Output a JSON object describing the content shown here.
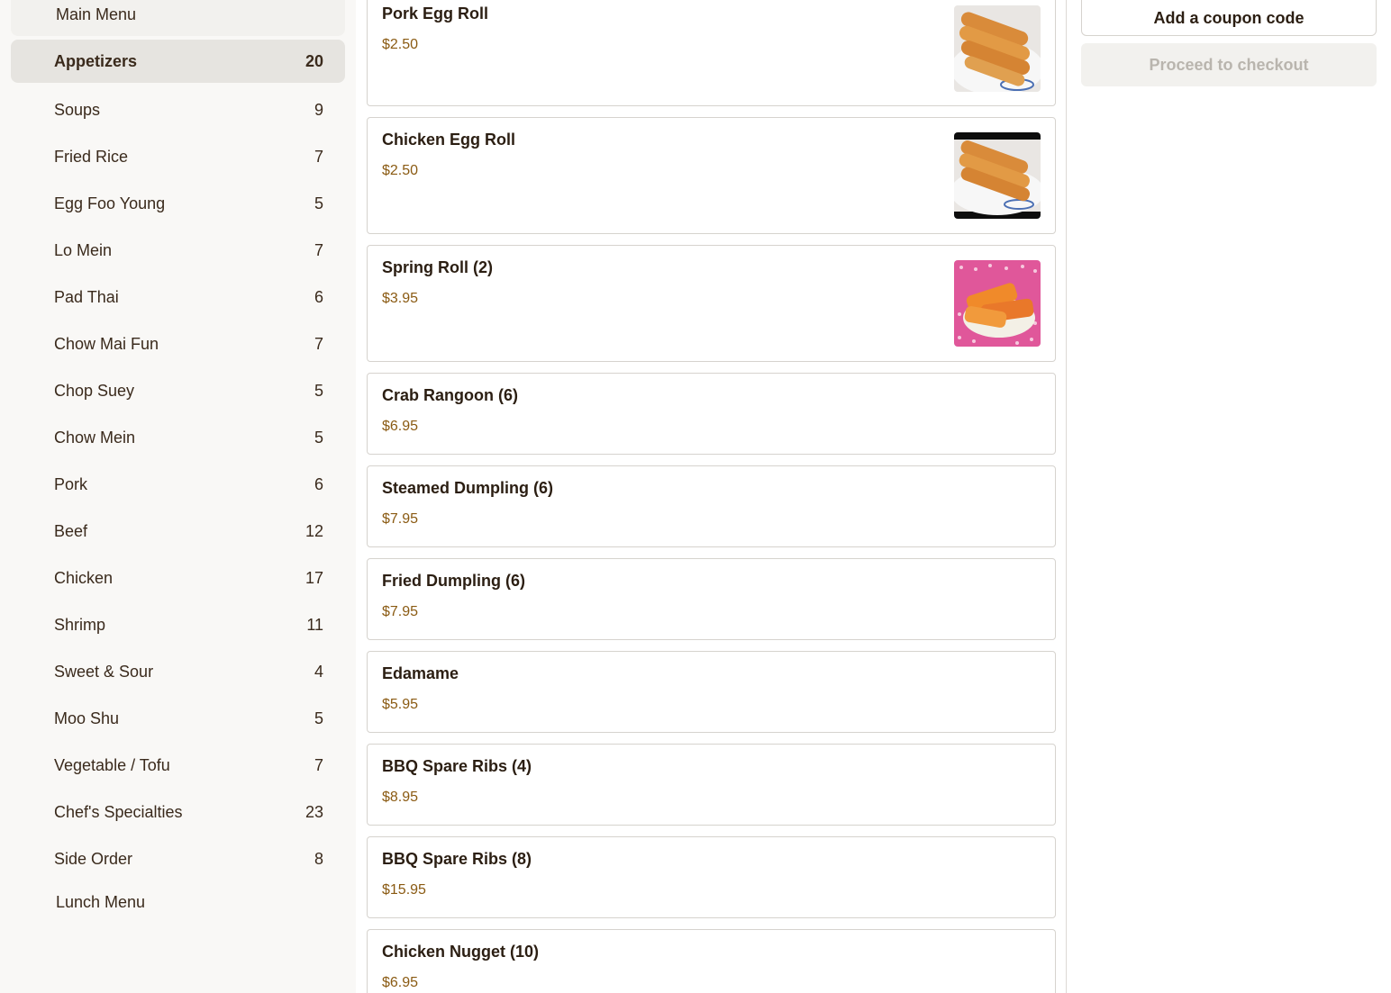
{
  "sidebar": {
    "main_menu_label": "Main Menu",
    "lunch_menu_label": "Lunch Menu",
    "categories": [
      {
        "label": "Appetizers",
        "count": "20"
      },
      {
        "label": "Soups",
        "count": "9"
      },
      {
        "label": "Fried Rice",
        "count": "7"
      },
      {
        "label": "Egg Foo Young",
        "count": "5"
      },
      {
        "label": "Lo Mein",
        "count": "7"
      },
      {
        "label": "Pad Thai",
        "count": "6"
      },
      {
        "label": "Chow Mai Fun",
        "count": "7"
      },
      {
        "label": "Chop Suey",
        "count": "5"
      },
      {
        "label": "Chow Mein",
        "count": "5"
      },
      {
        "label": "Pork",
        "count": "6"
      },
      {
        "label": "Beef",
        "count": "12"
      },
      {
        "label": "Chicken",
        "count": "17"
      },
      {
        "label": "Shrimp",
        "count": "11"
      },
      {
        "label": "Sweet & Sour",
        "count": "4"
      },
      {
        "label": "Moo Shu",
        "count": "5"
      },
      {
        "label": "Vegetable / Tofu",
        "count": "7"
      },
      {
        "label": "Chef's Specialties",
        "count": "23"
      },
      {
        "label": "Side Order",
        "count": "8"
      }
    ],
    "active_category": "Appetizers"
  },
  "menu_items": [
    {
      "name": "Pork Egg Roll",
      "price": "$2.50",
      "image": "egg-roll-photo"
    },
    {
      "name": "Chicken Egg Roll",
      "price": "$2.50",
      "image": "egg-roll-photo"
    },
    {
      "name": "Spring Roll (2)",
      "price": "$3.95",
      "image": "spring-roll-photo"
    },
    {
      "name": "Crab Rangoon (6)",
      "price": "$6.95"
    },
    {
      "name": "Steamed Dumpling (6)",
      "price": "$7.95"
    },
    {
      "name": "Fried Dumpling (6)",
      "price": "$7.95"
    },
    {
      "name": "Edamame",
      "price": "$5.95"
    },
    {
      "name": "BBQ Spare Ribs (4)",
      "price": "$8.95"
    },
    {
      "name": "BBQ Spare Ribs (8)",
      "price": "$15.95"
    },
    {
      "name": "Chicken Nugget (10)",
      "price": "$6.95"
    }
  ],
  "cart": {
    "coupon_label": "Add a coupon code",
    "checkout_label": "Proceed to checkout",
    "checkout_disabled": true
  },
  "colors": {
    "price": "#8a5a12",
    "sidebar_bg": "#f9f8f6",
    "active_bg": "#e6e4e0",
    "checkout_disabled_bg": "#f2f1ee"
  }
}
